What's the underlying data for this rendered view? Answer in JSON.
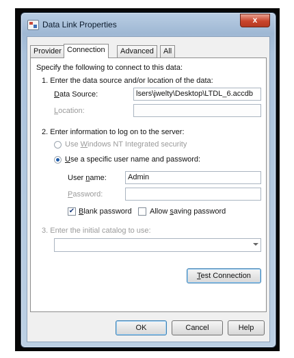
{
  "window": {
    "title": "Data Link Properties",
    "close_glyph": "x"
  },
  "tabs": [
    {
      "label": "Provider"
    },
    {
      "label": "Connection"
    },
    {
      "label": "Advanced"
    },
    {
      "label": "All"
    }
  ],
  "connection": {
    "intro": "Specify the following to connect to this data:",
    "step1": "1. Enter the data source and/or location of the data:",
    "data_source_label": "Data Source:",
    "data_source_value": "lsers\\jwelty\\Desktop\\LTDL_6.accdb",
    "location_label": "Location:",
    "location_value": "",
    "step2": "2. Enter information to log on to the server:",
    "radio_nt": "Use Windows NT Integrated security",
    "radio_specific": "Use a specific user name and password:",
    "username_label": "User name:",
    "username_value": "Admin",
    "password_label": "Password:",
    "password_value": "",
    "blank_password": "Blank password",
    "blank_password_checked": true,
    "allow_saving": "Allow saving password",
    "allow_saving_checked": false,
    "step3": "3. Enter the initial catalog to use:",
    "catalog_value": "",
    "test_button": "Test Connection"
  },
  "buttons": {
    "ok": "OK",
    "cancel": "Cancel",
    "help": "Help"
  }
}
